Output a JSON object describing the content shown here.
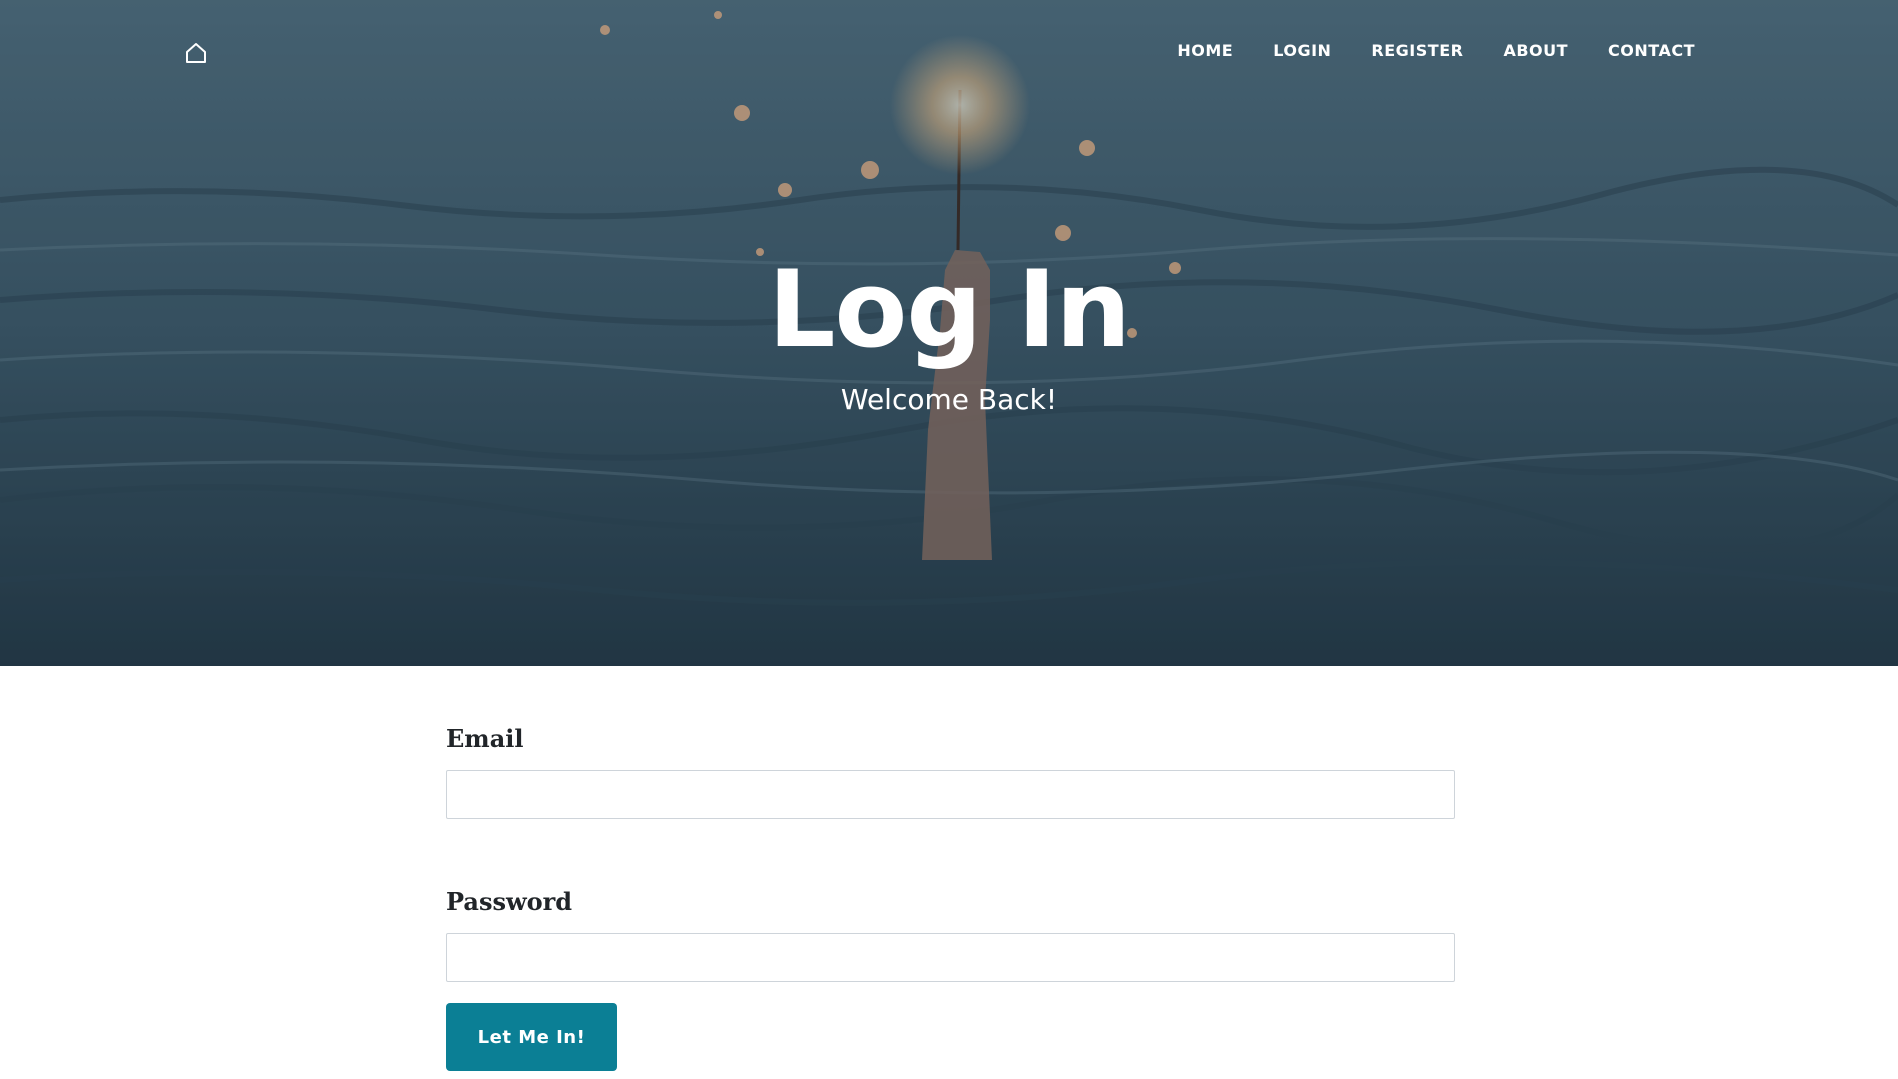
{
  "nav": {
    "home_icon": "home-icon",
    "items": [
      {
        "label": "HOME"
      },
      {
        "label": "LOGIN"
      },
      {
        "label": "REGISTER"
      },
      {
        "label": "ABOUT"
      },
      {
        "label": "CONTACT"
      }
    ]
  },
  "hero": {
    "title": "Log In",
    "subtitle": "Welcome Back!"
  },
  "form": {
    "email_label": "Email",
    "email_value": "",
    "email_placeholder": "",
    "password_label": "Password",
    "password_value": "",
    "password_placeholder": "",
    "submit_label": "Let Me In!"
  },
  "colors": {
    "accent": "#0b7f95",
    "hero_overlay": "#2e4a59",
    "text": "#212529"
  }
}
